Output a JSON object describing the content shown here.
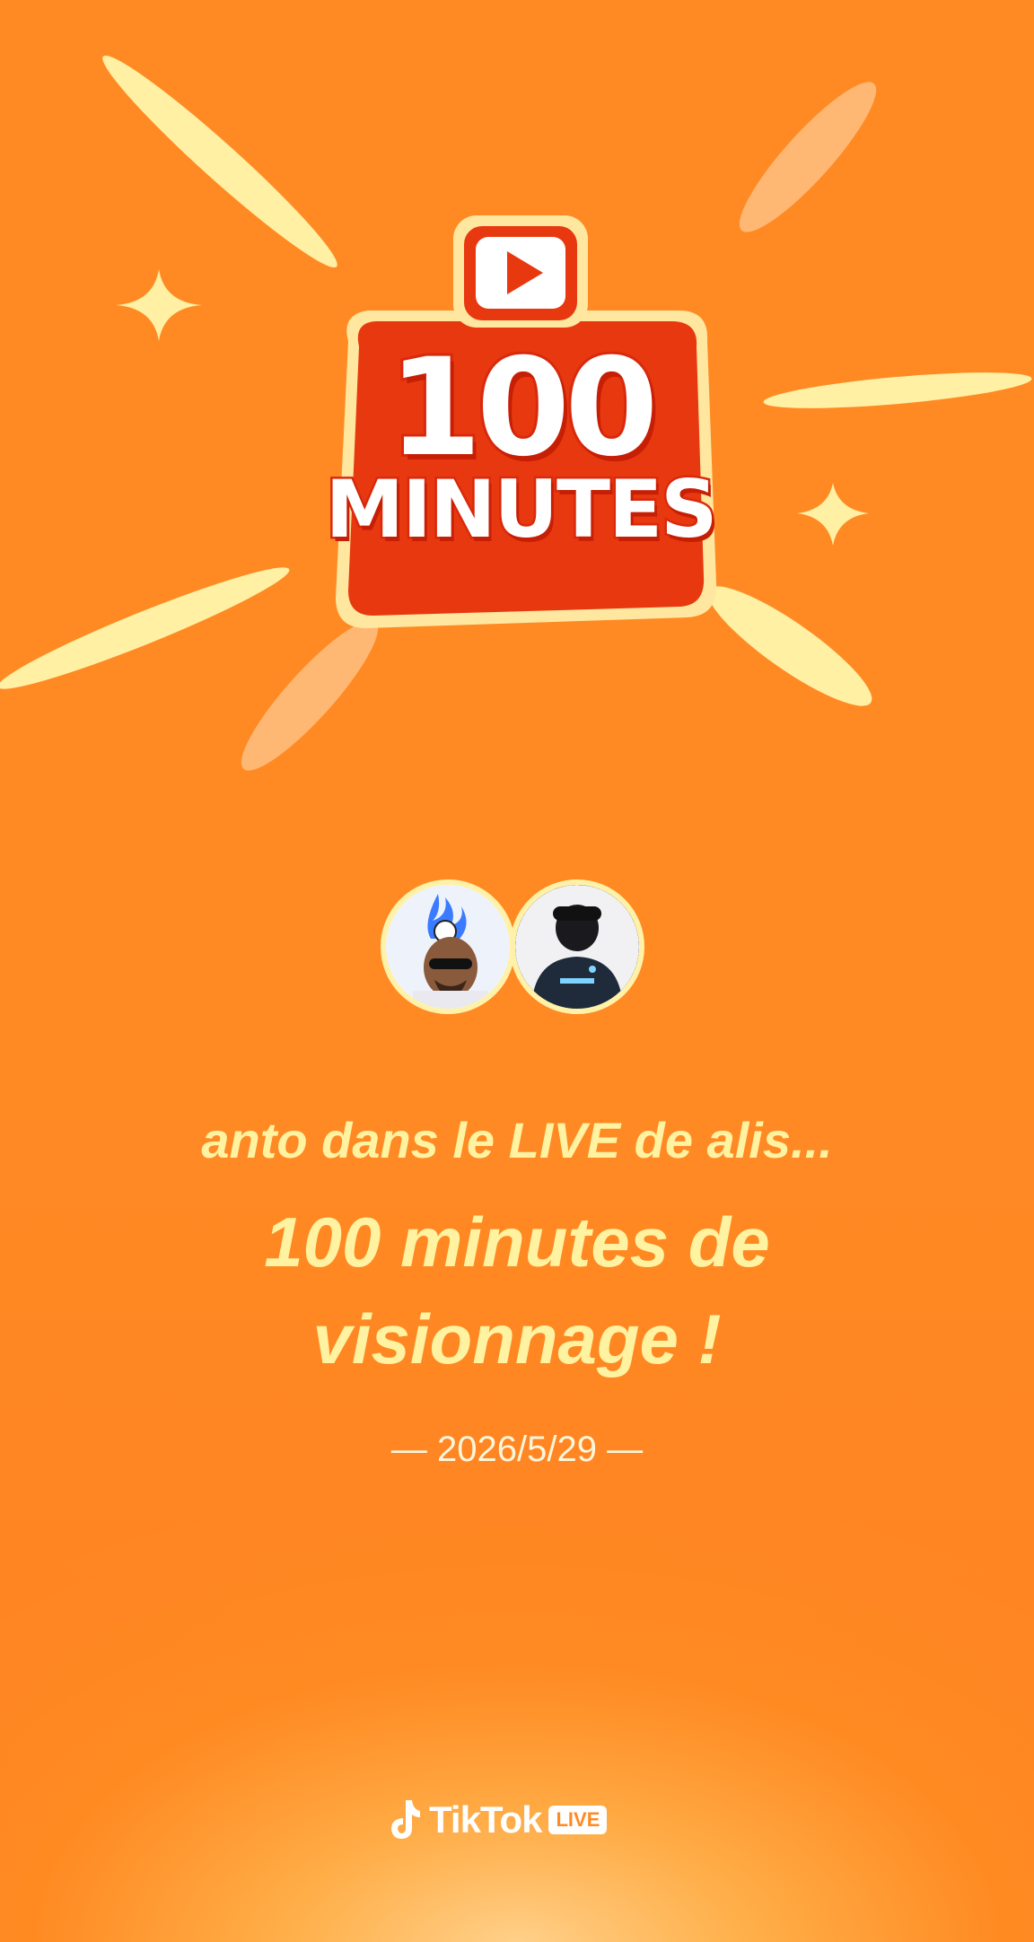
{
  "badge": {
    "number": "100",
    "word": "MINUTES",
    "icon": "play-icon"
  },
  "avatars": [
    {
      "name": "avatar-viewer",
      "icon": "avatar-cartoon-icon"
    },
    {
      "name": "avatar-host",
      "icon": "avatar-jersey-icon"
    }
  ],
  "caption": {
    "line1": "anto dans le LIVE de alis...",
    "line2a": "100 minutes de",
    "line2b": "visionnage !"
  },
  "date": "— 2026/5/29 —",
  "brand": {
    "name": "TikTok",
    "tag": "LIVE",
    "icon": "tiktok-note-icon"
  },
  "colors": {
    "background": "#ff8a24",
    "caption": "#fff2a0",
    "badge_red": "#e8380f",
    "ray": "#fff1a6"
  }
}
